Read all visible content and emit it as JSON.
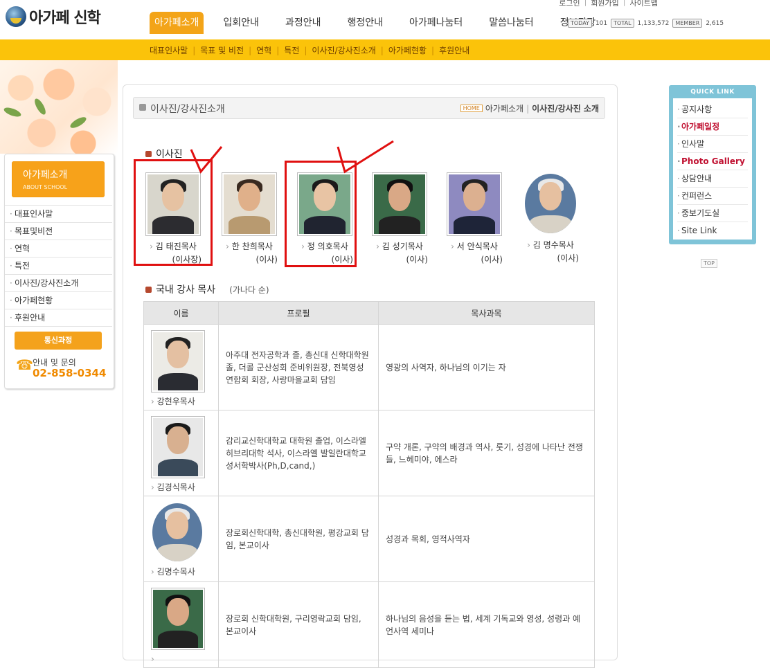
{
  "header": {
    "logo_text": "아가페 신학",
    "utility": [
      "로그인",
      "회원가입",
      "사이트맵"
    ],
    "gnb": [
      "아가페소개",
      "입회안내",
      "과정안내",
      "행정안내",
      "아가페나눔터",
      "말씀나눔터",
      "정보광장"
    ],
    "counters": {
      "today_label": "TODAY",
      "today": "101",
      "total_label": "TOTAL",
      "total": "1,133,572",
      "member_label": "MEMBER",
      "member": "2,615"
    },
    "subnav": [
      "대표인사말",
      "목표 및 비전",
      "연혁",
      "특전",
      "이사진/강사진소개",
      "아가페현황",
      "후원안내"
    ]
  },
  "sidebar": {
    "title": "아가페소개",
    "subtitle": "ABOUT SCHOOL",
    "items": [
      "대표인사말",
      "목표및비전",
      "연혁",
      "특전",
      "이사진/강사진소개",
      "아가페현황",
      "후원안내"
    ],
    "button": "통신과정",
    "inquiry_label": "안내 및 문의",
    "phone": "02-858-0344"
  },
  "page": {
    "title": "이사진/강사진소개",
    "breadcrumb": {
      "home": "HOME",
      "parent": "아가페소개",
      "current": "이사진/강사진 소개"
    }
  },
  "board": {
    "heading": "이사진",
    "members": [
      {
        "name": "김 태진목사",
        "role": "(이사장)",
        "highlighted": true
      },
      {
        "name": "한 찬희목사",
        "role": "(이사)",
        "highlighted": false
      },
      {
        "name": "정 의호목사",
        "role": "(이사)",
        "highlighted": true
      },
      {
        "name": "김 성기목사",
        "role": "(이사)",
        "highlighted": false
      },
      {
        "name": "서 안식목사",
        "role": "(이사)",
        "highlighted": false
      },
      {
        "name": "김 명수목사",
        "role": "(이사)",
        "highlighted": false
      }
    ]
  },
  "lecturers": {
    "heading": "국내 강사 목사",
    "note": "(가나다 순)",
    "columns": [
      "이름",
      "프로필",
      "목사과목"
    ],
    "rows": [
      {
        "name": "강현우목사",
        "profile": "아주대 전자공학과 졸, 총신대 신학대학원 졸, 더콜 군산성회 준비위원장, 전북영성연합회 회장, 사랑마을교회 담임",
        "subjects": "영광의 사역자, 하나님의 이기는 자"
      },
      {
        "name": "김경식목사",
        "profile": "감리교신학대학교 대학원 졸업, 이스라엘 히브리대학 석사, 이스라엘 발일란대학교 성서학박사(Ph,D,cand,)",
        "subjects": "구약 개론, 구약의 배경과 역사, 룻기, 성경에 나타난 전쟁들, 느헤미야, 에스라"
      },
      {
        "name": "김명수목사",
        "profile": "장로회신학대학, 총신대학원, 평강교회 담임, 본교이사",
        "subjects": "성경과 목회, 영적사역자"
      },
      {
        "name": "",
        "profile": "장로회 신학대학원, 구리영락교회 담임, 본교이사",
        "subjects": "하나님의 음성을 듣는 법, 세계 기독교와 영성, 성령과 예언사역 세미나"
      }
    ]
  },
  "quick_link": {
    "title": "QUICK LINK",
    "items": [
      "공지사항",
      "아가페일정",
      "인사말",
      "Photo Gallery",
      "상담안내",
      "컨퍼런스",
      "중보기도실",
      "Site Link"
    ]
  },
  "top_button": "TOP",
  "colors": {
    "accent": "#f3a418",
    "subbar": "#fbc30a",
    "quick": "#7fc4d8",
    "annotation": "#e01010"
  }
}
